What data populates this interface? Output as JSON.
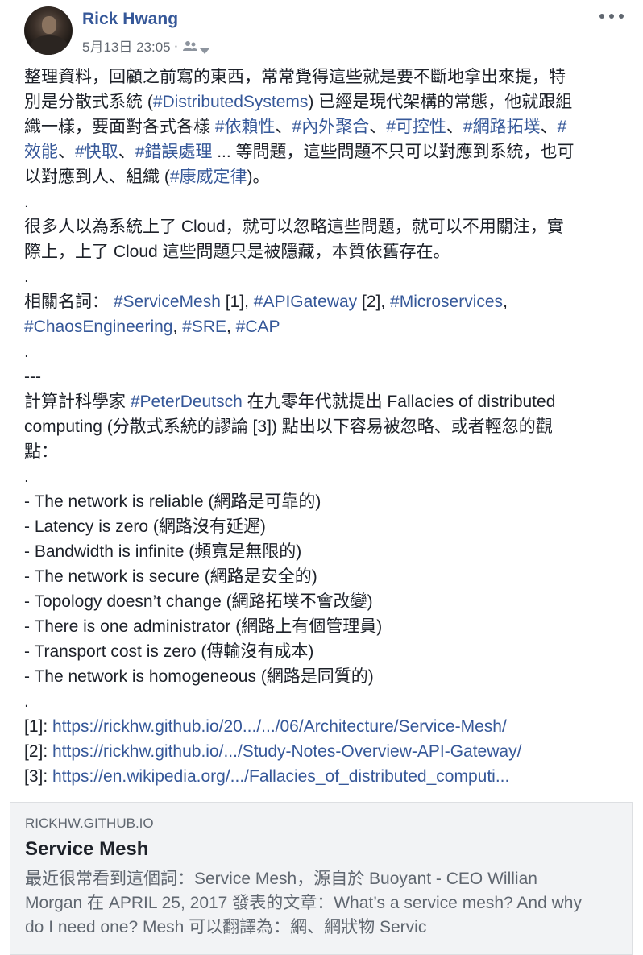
{
  "post": {
    "author": "Rick Hwang",
    "timestamp": "5月13日 23:05",
    "separator": "·",
    "audience_icon": "friends-icon",
    "more_icon": "more-options-icon",
    "lines": [
      [
        {
          "t": "整理資料，回顧之前寫的東西，常常覺得這些就是要不斷地拿出來提，特"
        }
      ],
      [
        {
          "t": "別是分散式系統 ("
        },
        {
          "t": "#DistributedSystems",
          "link": true
        },
        {
          "t": ") 已經是現代架構的常態，他就跟組"
        }
      ],
      [
        {
          "t": "織一樣，要面對各式各樣 "
        },
        {
          "t": "#依賴性",
          "link": true
        },
        {
          "t": "、"
        },
        {
          "t": "#內外聚合",
          "link": true
        },
        {
          "t": "、"
        },
        {
          "t": "#可控性",
          "link": true
        },
        {
          "t": "、"
        },
        {
          "t": "#網路拓墣",
          "link": true
        },
        {
          "t": "、"
        },
        {
          "t": "#",
          "link": true
        }
      ],
      [
        {
          "t": "效能",
          "link": true
        },
        {
          "t": "、"
        },
        {
          "t": "#快取",
          "link": true
        },
        {
          "t": "、"
        },
        {
          "t": "#錯誤處理",
          "link": true
        },
        {
          "t": " ... 等問題，這些問題不只可以對應到系統，也可"
        }
      ],
      [
        {
          "t": "以對應到人、組織 ("
        },
        {
          "t": "#康威定律",
          "link": true
        },
        {
          "t": ")。"
        }
      ],
      [
        {
          "t": "."
        }
      ],
      [
        {
          "t": "很多人以為系統上了 Cloud，就可以忽略這些問題，就可以不用關注，實"
        }
      ],
      [
        {
          "t": "際上，上了 Cloud 這些問題只是被隱藏，本質依舊存在。"
        }
      ],
      [
        {
          "t": "."
        }
      ],
      [
        {
          "t": "相關名詞： "
        },
        {
          "t": "#ServiceMesh",
          "link": true
        },
        {
          "t": " [1], "
        },
        {
          "t": "#APIGateway",
          "link": true
        },
        {
          "t": " [2], "
        },
        {
          "t": "#Microservices",
          "link": true
        },
        {
          "t": ","
        }
      ],
      [
        {
          "t": "#ChaosEngineering",
          "link": true
        },
        {
          "t": ", "
        },
        {
          "t": "#SRE",
          "link": true
        },
        {
          "t": ", "
        },
        {
          "t": "#CAP",
          "link": true
        }
      ],
      [
        {
          "t": "."
        }
      ],
      [
        {
          "t": "---"
        }
      ],
      [
        {
          "t": "計算計科學家 "
        },
        {
          "t": "#PeterDeutsch",
          "link": true
        },
        {
          "t": " 在九零年代就提出 Fallacies of distributed"
        }
      ],
      [
        {
          "t": "computing (分散式系統的謬論 [3]) 點出以下容易被忽略、或者輕忽的觀"
        }
      ],
      [
        {
          "t": "點："
        }
      ],
      [
        {
          "t": "."
        }
      ],
      [
        {
          "t": "- The network is reliable (網路是可靠的)"
        }
      ],
      [
        {
          "t": "- Latency is zero (網路沒有延遲)"
        }
      ],
      [
        {
          "t": "- Bandwidth is infinite (頻寬是無限的)"
        }
      ],
      [
        {
          "t": "- The network is secure (網路是安全的)"
        }
      ],
      [
        {
          "t": "- Topology doesn’t change (網路拓墣不會改變)"
        }
      ],
      [
        {
          "t": "- There is one administrator (網路上有個管理員)"
        }
      ],
      [
        {
          "t": "- Transport cost is zero (傳輸沒有成本)"
        }
      ],
      [
        {
          "t": "- The network is homogeneous (網路是同質的)"
        }
      ],
      [
        {
          "t": "."
        }
      ],
      [
        {
          "t": "[1]: "
        },
        {
          "t": "https://rickhw.github.io/20.../.../06/Architecture/Service-Mesh/",
          "link": true
        }
      ],
      [
        {
          "t": "[2]: "
        },
        {
          "t": "https://rickhw.github.io/.../Study-Notes-Overview-API-Gateway/",
          "link": true
        }
      ],
      [
        {
          "t": "[3]: "
        },
        {
          "t": "https://en.wikipedia.org/.../Fallacies_of_distributed_computi...",
          "link": true
        }
      ]
    ]
  },
  "link_card": {
    "domain": "RICKHW.GITHUB.IO",
    "title": "Service Mesh",
    "description_lines": [
      "最近很常看到這個詞：Service Mesh，源自於 Buoyant - CEO Willian",
      "Morgan 在 APRIL 25, 2017 發表的文章：What’s a service mesh? And why",
      "do I need one? Mesh 可以翻譯為：網、網狀物 Servic"
    ]
  },
  "colors": {
    "link": "#365899",
    "text": "#1d2129",
    "meta": "#616770",
    "card_bg": "#f2f3f5"
  }
}
